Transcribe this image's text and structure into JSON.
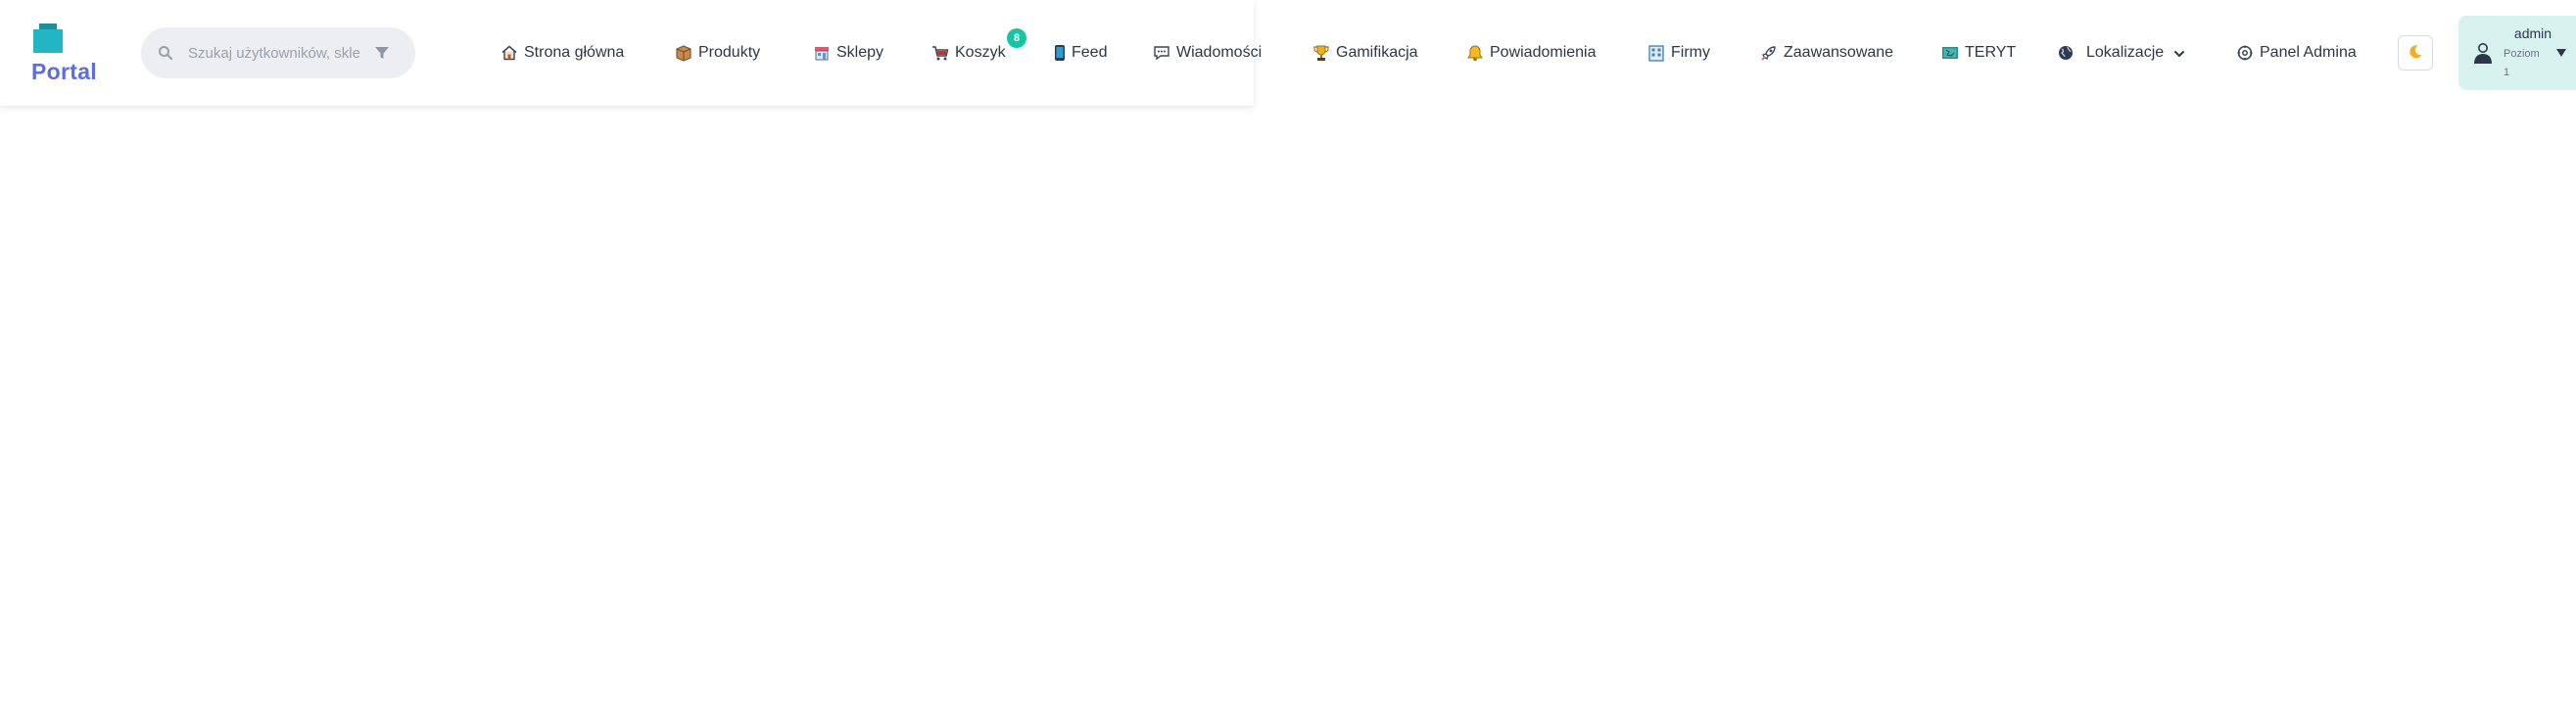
{
  "brand": {
    "name": "Portal",
    "logo_icon": "stacked-box-icon",
    "colors": {
      "logo_primary": "#22b5c4",
      "logo_text": "#5b6ee1"
    }
  },
  "search": {
    "placeholder": "Szukaj użytkowników, sklepów",
    "value": "",
    "icon": "search-icon",
    "filter_icon": "filter-icon"
  },
  "nav": {
    "items": [
      {
        "label": "Strona główna",
        "icon": "home-icon"
      },
      {
        "label": "Produkty",
        "icon": "box-icon"
      },
      {
        "label": "Sklepy",
        "icon": "store-icon"
      },
      {
        "label": "Koszyk",
        "icon": "cart-icon",
        "badge": "8"
      },
      {
        "label": "Feed",
        "icon": "phone-icon"
      },
      {
        "label": "Wiadomości",
        "icon": "chat-icon"
      },
      {
        "label": "Gamifikacja",
        "icon": "trophy-icon"
      },
      {
        "label": "Powiadomienia",
        "icon": "bell-icon"
      },
      {
        "label": "Firmy",
        "icon": "building-icon"
      },
      {
        "label": "Zaawansowane",
        "icon": "rocket-icon"
      },
      {
        "label": "TERYT",
        "icon": "map-book-icon"
      },
      {
        "label": "Lokalizacje",
        "icon": "globe-icon",
        "dropdown": true
      },
      {
        "label": "Panel Admina",
        "icon": "gear-icon"
      }
    ],
    "badge_color": "#19c3a6"
  },
  "theme_toggle": {
    "icon": "moon-icon"
  },
  "user": {
    "name": "admin",
    "level_label": "Poziom",
    "level_value": "1",
    "avatar_icon": "user-avatar-icon",
    "menu_icon": "caret-down-icon",
    "colors": {
      "background": "#d8f3ef"
    }
  }
}
